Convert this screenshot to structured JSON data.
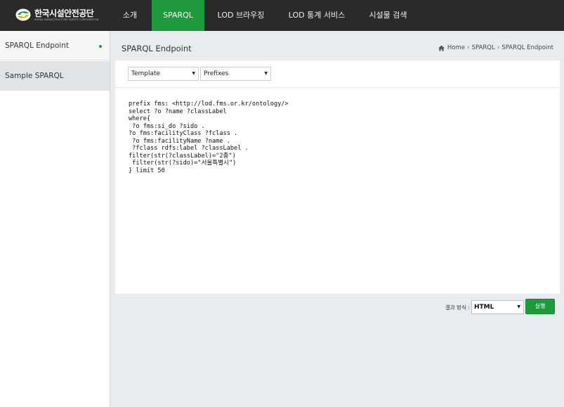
{
  "brand": {
    "name": "한국시설안전공단",
    "subtitle": "KOREA INFRASTRUCTURE SAFETY CORPORATION",
    "color": "#1e9a3c"
  },
  "nav": {
    "items": [
      {
        "label": "소개"
      },
      {
        "label": "SPARQL"
      },
      {
        "label": "LOD 브라우징"
      },
      {
        "label": "LOD 통계 서비스"
      },
      {
        "label": "시설물 검색"
      }
    ],
    "active": "SPARQL"
  },
  "sidebar": {
    "items": [
      {
        "label": "SPARQL Endpoint"
      },
      {
        "label": "Sample SPARQL"
      }
    ]
  },
  "page": {
    "title": "SPARQL Endpoint",
    "breadcrumb": [
      "Home",
      "SPARQL",
      "SPARQL Endpoint"
    ]
  },
  "toolbar": {
    "template_select": "Template",
    "prefixes_select": "Prefixes"
  },
  "query": "prefix fms: <http://lod.fms.or.kr/ontology/>\nselect ?o ?name ?classLabel\nwhere{\n ?o fms:si_do ?sido .\n?o fms:facilityClass ?fclass .\n ?o fms:facilityName ?name .\n ?fclass rdfs:label ?classLabel .\nfilter(str(?classLabel)=\"2종\")\n filter(str(?sido)=\"서울특별시\")\n} limit 50",
  "result": {
    "label": "결과 방식 :",
    "format": "HTML",
    "run_label": "실행"
  }
}
